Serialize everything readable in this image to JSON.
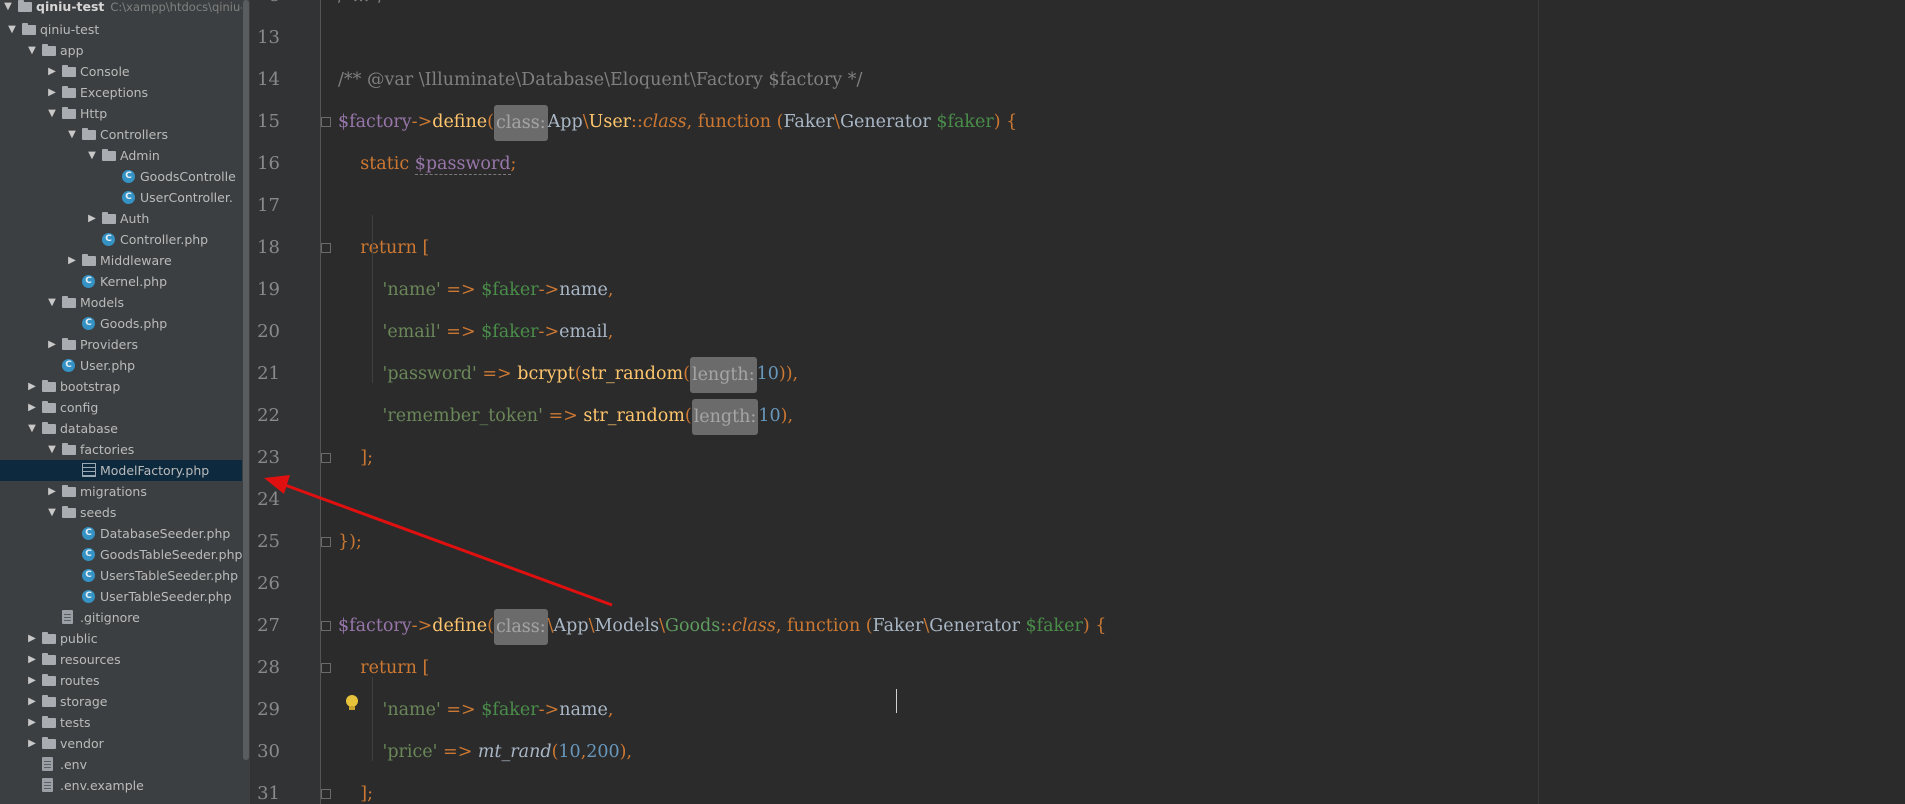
{
  "project": {
    "root_name": "qiniu-test",
    "root_path": "C:\\xampp\\htdocs\\qiniu-",
    "items": [
      {
        "label": "qiniu-test",
        "depth": 1,
        "kind": "folder",
        "state": "open"
      },
      {
        "label": "app",
        "depth": 2,
        "kind": "folder",
        "state": "open"
      },
      {
        "label": "Console",
        "depth": 3,
        "kind": "folder",
        "state": "closed"
      },
      {
        "label": "Exceptions",
        "depth": 3,
        "kind": "folder",
        "state": "closed"
      },
      {
        "label": "Http",
        "depth": 3,
        "kind": "folder",
        "state": "open"
      },
      {
        "label": "Controllers",
        "depth": 4,
        "kind": "folder",
        "state": "open"
      },
      {
        "label": "Admin",
        "depth": 5,
        "kind": "folder",
        "state": "open"
      },
      {
        "label": "GoodsControlle",
        "depth": 6,
        "kind": "class"
      },
      {
        "label": "UserController.",
        "depth": 6,
        "kind": "class"
      },
      {
        "label": "Auth",
        "depth": 5,
        "kind": "folder",
        "state": "closed"
      },
      {
        "label": "Controller.php",
        "depth": 5,
        "kind": "class"
      },
      {
        "label": "Middleware",
        "depth": 4,
        "kind": "folder",
        "state": "closed"
      },
      {
        "label": "Kernel.php",
        "depth": 4,
        "kind": "class"
      },
      {
        "label": "Models",
        "depth": 3,
        "kind": "folder",
        "state": "open"
      },
      {
        "label": "Goods.php",
        "depth": 4,
        "kind": "class"
      },
      {
        "label": "Providers",
        "depth": 3,
        "kind": "folder",
        "state": "closed"
      },
      {
        "label": "User.php",
        "depth": 3,
        "kind": "class"
      },
      {
        "label": "bootstrap",
        "depth": 2,
        "kind": "folder",
        "state": "closed"
      },
      {
        "label": "config",
        "depth": 2,
        "kind": "folder",
        "state": "closed"
      },
      {
        "label": "database",
        "depth": 2,
        "kind": "folder",
        "state": "open"
      },
      {
        "label": "factories",
        "depth": 3,
        "kind": "folder",
        "state": "open"
      },
      {
        "label": "ModelFactory.php",
        "depth": 4,
        "kind": "factory",
        "selected": true
      },
      {
        "label": "migrations",
        "depth": 3,
        "kind": "folder",
        "state": "closed"
      },
      {
        "label": "seeds",
        "depth": 3,
        "kind": "folder",
        "state": "open"
      },
      {
        "label": "DatabaseSeeder.php",
        "depth": 4,
        "kind": "class"
      },
      {
        "label": "GoodsTableSeeder.php",
        "depth": 4,
        "kind": "class"
      },
      {
        "label": "UsersTableSeeder.php",
        "depth": 4,
        "kind": "class"
      },
      {
        "label": "UserTableSeeder.php",
        "depth": 4,
        "kind": "class"
      },
      {
        "label": ".gitignore",
        "depth": 3,
        "kind": "doc"
      },
      {
        "label": "public",
        "depth": 2,
        "kind": "folder",
        "state": "closed"
      },
      {
        "label": "resources",
        "depth": 2,
        "kind": "folder",
        "state": "closed"
      },
      {
        "label": "routes",
        "depth": 2,
        "kind": "folder",
        "state": "closed"
      },
      {
        "label": "storage",
        "depth": 2,
        "kind": "folder",
        "state": "closed"
      },
      {
        "label": "tests",
        "depth": 2,
        "kind": "folder",
        "state": "closed"
      },
      {
        "label": "vendor",
        "depth": 2,
        "kind": "folder",
        "state": "closed"
      },
      {
        "label": ".env",
        "depth": 2,
        "kind": "doc"
      },
      {
        "label": ".env.example",
        "depth": 2,
        "kind": "doc"
      }
    ]
  },
  "editor": {
    "lines": [
      {
        "n": "13",
        "tokens": []
      },
      {
        "n": "14",
        "tokens": [
          [
            "cmt",
            "/** @var \\Illuminate\\Database\\Eloquent\\Factory $factory */"
          ]
        ]
      },
      {
        "n": "15",
        "tokens": [
          [
            "var",
            "$factory"
          ],
          [
            "op",
            "->"
          ],
          [
            "fn",
            "define"
          ],
          [
            "op",
            "("
          ],
          [
            "hint",
            "class:"
          ],
          [
            "ns",
            "App"
          ],
          [
            "op",
            "\\"
          ],
          [
            "fn",
            "User"
          ],
          [
            "op",
            "::"
          ],
          [
            "kw ital",
            "class"
          ],
          [
            "op",
            ", "
          ],
          [
            "kw",
            "function "
          ],
          [
            "op",
            "("
          ],
          [
            "ns",
            "Faker"
          ],
          [
            "op",
            "\\"
          ],
          [
            "ns",
            "Generator "
          ],
          [
            "varg",
            "$faker"
          ],
          [
            "op",
            ") {"
          ]
        ]
      },
      {
        "n": "16",
        "tokens": [
          [
            "sp",
            "    "
          ],
          [
            "kw",
            "static "
          ],
          [
            "var under",
            "$password"
          ],
          [
            "op",
            ";"
          ]
        ]
      },
      {
        "n": "17",
        "tokens": []
      },
      {
        "n": "18",
        "tokens": [
          [
            "sp",
            "    "
          ],
          [
            "kw",
            "return "
          ],
          [
            "op",
            "["
          ]
        ]
      },
      {
        "n": "19",
        "tokens": [
          [
            "sp",
            "        "
          ],
          [
            "str",
            "'name'"
          ],
          [
            "op",
            " => "
          ],
          [
            "varg",
            "$faker"
          ],
          [
            "op",
            "->"
          ],
          [
            "ns",
            "name"
          ],
          [
            "op",
            ","
          ]
        ]
      },
      {
        "n": "20",
        "tokens": [
          [
            "sp",
            "        "
          ],
          [
            "str",
            "'email'"
          ],
          [
            "op",
            " => "
          ],
          [
            "varg",
            "$faker"
          ],
          [
            "op",
            "->"
          ],
          [
            "ns",
            "email"
          ],
          [
            "op",
            ","
          ]
        ]
      },
      {
        "n": "21",
        "tokens": [
          [
            "sp",
            "        "
          ],
          [
            "str",
            "'password'"
          ],
          [
            "op",
            " => "
          ],
          [
            "fn",
            "bcrypt"
          ],
          [
            "op",
            "("
          ],
          [
            "fn",
            "str_random"
          ],
          [
            "op",
            "("
          ],
          [
            "hint",
            "length:"
          ],
          [
            "num",
            "10"
          ],
          [
            "op",
            ")),"
          ]
        ]
      },
      {
        "n": "22",
        "tokens": [
          [
            "sp",
            "        "
          ],
          [
            "str",
            "'remember_token'"
          ],
          [
            "op",
            " => "
          ],
          [
            "fn",
            "str_random"
          ],
          [
            "op",
            "("
          ],
          [
            "hint",
            "length:"
          ],
          [
            "num",
            "10"
          ],
          [
            "op",
            "),"
          ]
        ]
      },
      {
        "n": "23",
        "tokens": [
          [
            "sp",
            "    "
          ],
          [
            "op",
            "];"
          ]
        ]
      },
      {
        "n": "24",
        "tokens": []
      },
      {
        "n": "25",
        "tokens": [
          [
            "op",
            "});"
          ]
        ]
      },
      {
        "n": "26",
        "tokens": []
      },
      {
        "n": "27",
        "tokens": [
          [
            "var",
            "$factory"
          ],
          [
            "op",
            "->"
          ],
          [
            "fn",
            "define"
          ],
          [
            "op",
            "("
          ],
          [
            "hint",
            "class:"
          ],
          [
            "op",
            "\\"
          ],
          [
            "ns",
            "App"
          ],
          [
            "op",
            "\\"
          ],
          [
            "ns",
            "Models"
          ],
          [
            "op",
            "\\"
          ],
          [
            "grn",
            "Goods"
          ],
          [
            "op",
            "::"
          ],
          [
            "kw ital",
            "class"
          ],
          [
            "op",
            ", "
          ],
          [
            "kw",
            "function "
          ],
          [
            "op",
            "("
          ],
          [
            "ns",
            "Faker"
          ],
          [
            "op",
            "\\"
          ],
          [
            "ns",
            "Generator "
          ],
          [
            "varg",
            "$faker"
          ],
          [
            "op",
            ") {"
          ]
        ]
      },
      {
        "n": "28",
        "tokens": [
          [
            "sp",
            "    "
          ],
          [
            "kw",
            "return "
          ],
          [
            "op",
            "["
          ]
        ]
      },
      {
        "n": "29",
        "tokens": [
          [
            "sp",
            "        "
          ],
          [
            "str",
            "'name'"
          ],
          [
            "op",
            " => "
          ],
          [
            "varg",
            "$faker"
          ],
          [
            "op",
            "->"
          ],
          [
            "ns",
            "name"
          ],
          [
            "op",
            ","
          ]
        ]
      },
      {
        "n": "30",
        "tokens": [
          [
            "sp",
            "        "
          ],
          [
            "str",
            "'price'"
          ],
          [
            "op",
            " => "
          ],
          [
            "ns ital",
            "mt_rand"
          ],
          [
            "op",
            "("
          ],
          [
            "num",
            "10"
          ],
          [
            "op",
            ","
          ],
          [
            "num",
            "200"
          ],
          [
            "op",
            "),"
          ]
        ]
      },
      {
        "n": "31",
        "tokens": [
          [
            "sp",
            "    "
          ],
          [
            "op",
            "];"
          ]
        ]
      }
    ],
    "top_partial": "/*...*/",
    "top_partial_num": "8",
    "accent_arrow": "#e01010"
  }
}
